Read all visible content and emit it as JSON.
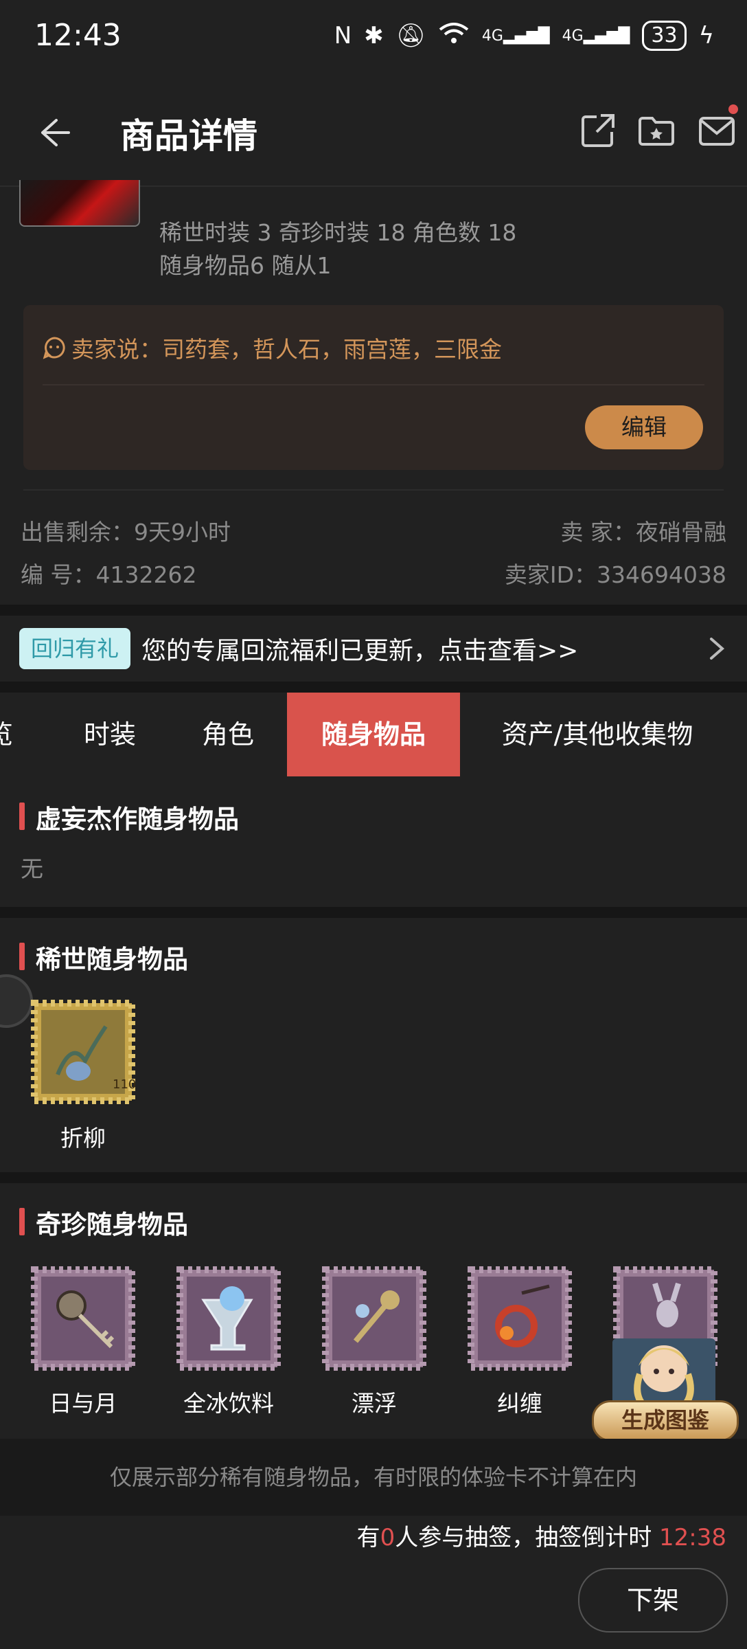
{
  "status_bar": {
    "time": "12:43",
    "network": "4G",
    "battery": "33"
  },
  "header": {
    "title": "商品详情"
  },
  "summary": {
    "line1": "稀世时装 3 奇珍时装 18 角色数 18",
    "line2": "随身物品6 随从1"
  },
  "seller_note": {
    "text": "卖家说：司药套，哲人石，雨宫莲，三限金",
    "edit_label": "编辑"
  },
  "info": {
    "remain": "出售剩余：9天9小时",
    "number": "编  号：4132262",
    "seller": "卖  家：夜硝骨融",
    "seller_id": "卖家ID：334694038"
  },
  "banner": {
    "badge": "回归有礼",
    "text": "您的专属回流福利已更新，点击查看>>"
  },
  "tabs": [
    "览",
    "时装",
    "角色",
    "随身物品",
    "资产/其他收集物"
  ],
  "active_tab": 3,
  "sections": {
    "masterpiece": {
      "title": "虚妄杰作随身物品",
      "empty": "无"
    },
    "rare": {
      "title": "稀世随身物品",
      "items": [
        {
          "name": "折柳"
        }
      ]
    },
    "precious": {
      "title": "奇珍随身物品",
      "items": [
        {
          "name": "日与月"
        },
        {
          "name": "全冰饮料"
        },
        {
          "name": "漂浮"
        },
        {
          "name": "纠缠"
        },
        {
          "name": ""
        }
      ]
    }
  },
  "notice": "仅展示部分稀有随身物品，有时限的体验卡不计算在内",
  "lottery": {
    "prefix": "有",
    "count": "0",
    "middle": "人参与抽签，抽签倒计时 ",
    "time": "12:38"
  },
  "delist_label": "下架",
  "float_generator_label": "生成图鉴",
  "colors": {
    "accent_red": "#e05050",
    "tab_active": "#d9534c",
    "seller_text": "#d4965a",
    "edit_button": "#cc8a4a",
    "rare_stamp": "#c7a64a",
    "precious_stamp": "#9a7c95"
  }
}
